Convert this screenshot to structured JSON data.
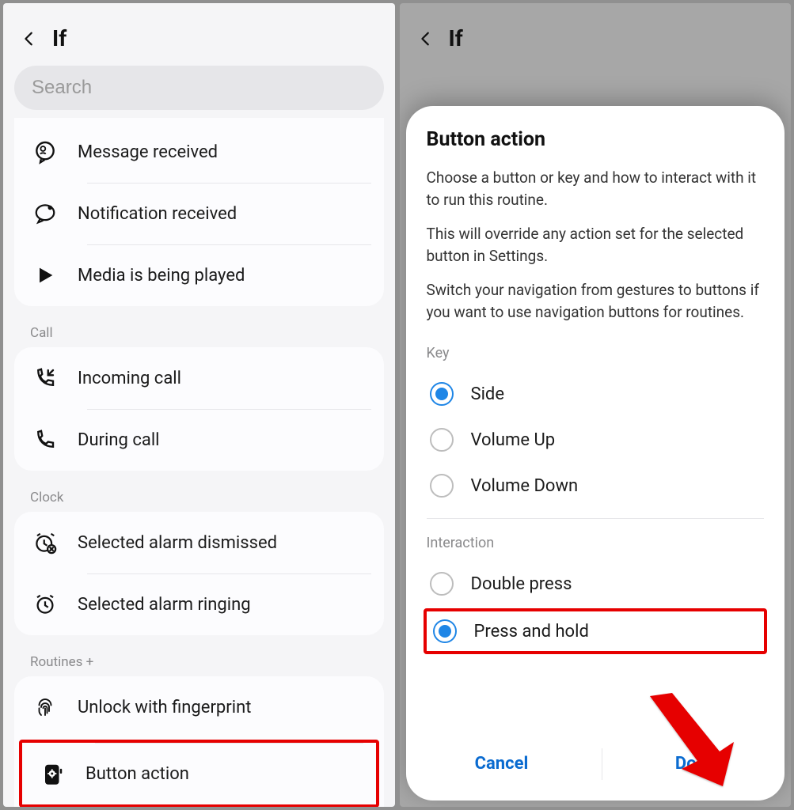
{
  "left": {
    "title": "If",
    "search_placeholder": "Search",
    "items_top": [
      {
        "label": "Message received",
        "icon": "message"
      },
      {
        "label": "Notification received",
        "icon": "notification"
      },
      {
        "label": "Media is being played",
        "icon": "play"
      }
    ],
    "section_call": "Call",
    "items_call": [
      {
        "label": "Incoming call",
        "icon": "incoming-call"
      },
      {
        "label": "During call",
        "icon": "during-call"
      }
    ],
    "section_clock": "Clock",
    "items_clock": [
      {
        "label": "Selected alarm dismissed",
        "icon": "alarm-dismissed"
      },
      {
        "label": "Selected alarm ringing",
        "icon": "alarm-ringing"
      }
    ],
    "section_routines": "Routines +",
    "items_routines": [
      {
        "label": "Unlock with fingerprint",
        "icon": "fingerprint"
      },
      {
        "label": "Button action",
        "icon": "gear-button",
        "highlight": true
      }
    ]
  },
  "right": {
    "title": "If",
    "sheet": {
      "title": "Button action",
      "desc1": "Choose a button or key and how to interact with it to run this routine.",
      "desc2": "This will override any action set for the selected button in Settings.",
      "desc3": "Switch your navigation from gestures to buttons if you want to use navigation buttons for routines.",
      "key_label": "Key",
      "keys": [
        {
          "label": "Side",
          "selected": true
        },
        {
          "label": "Volume Up",
          "selected": false
        },
        {
          "label": "Volume Down",
          "selected": false
        }
      ],
      "interaction_label": "Interaction",
      "interactions": [
        {
          "label": "Double press",
          "selected": false
        },
        {
          "label": "Press and hold",
          "selected": true,
          "highlight": true
        }
      ],
      "cancel": "Cancel",
      "done": "Done"
    }
  }
}
